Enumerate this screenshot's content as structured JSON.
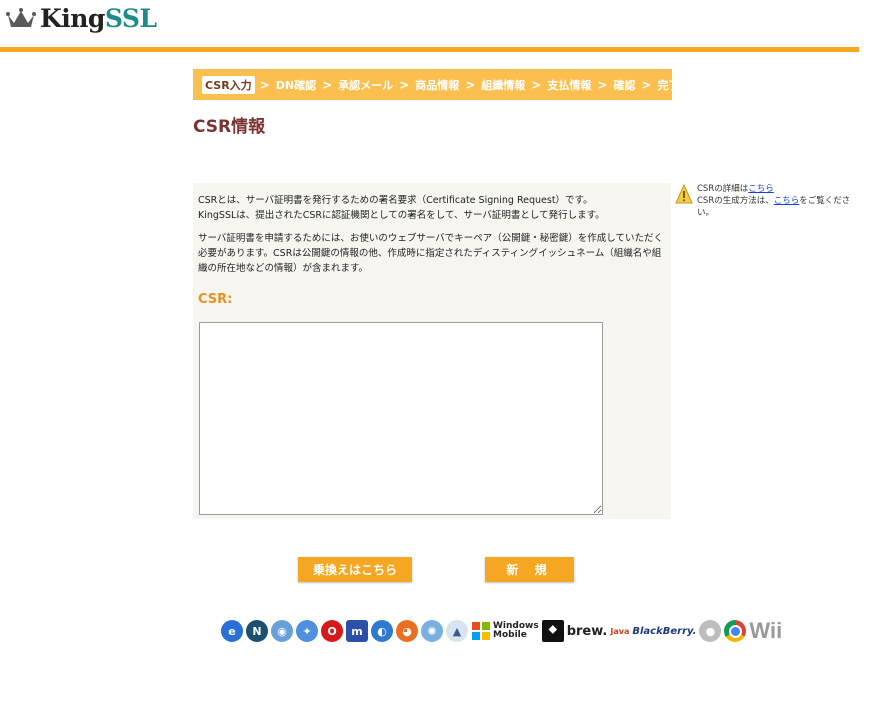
{
  "logo": {
    "text_king": "King",
    "text_ssl": "SSL"
  },
  "steps": [
    {
      "label": "CSR入力",
      "active": true
    },
    {
      "label": "DN確認"
    },
    {
      "label": "承認メール"
    },
    {
      "label": "商品情報"
    },
    {
      "label": "組織情報"
    },
    {
      "label": "支払情報"
    },
    {
      "label": "確認"
    },
    {
      "label": "完了"
    }
  ],
  "step_separator": ">",
  "page_title": "CSR情報",
  "description": {
    "p1_line1": "CSRとは、サーバ証明書を発行するための署名要求（Certificate Signing Request）です。",
    "p1_line2": "KingSSLは、提出されたCSRに認証機関としての署名をして、サーバ証明書として発行します。",
    "p2": "サーバ証明書を申請するためには、お使いのウェブサーバでキーペア（公開鍵・秘密鍵）を作成していただく必要があります。CSRは公開鍵の情報の他、作成時に指定されたディスティングイッシュネーム（組織名や組織の所在地などの情報）が含まれます。"
  },
  "csr_label": "CSR:",
  "csr_value": "",
  "side_note": {
    "line1_prefix": "CSRの詳細は",
    "line1_link": "こちら",
    "line2_prefix": "CSRの生成方法は、",
    "line2_link": "こちら",
    "line2_suffix": "をご覧ください。"
  },
  "buttons": {
    "switch": "乗換えはこちら",
    "new": "新 規"
  },
  "browser_strip": {
    "icons": [
      "ie-icon",
      "netscape-icon",
      "mozilla-icon",
      "safari-icon",
      "opera-icon",
      "konqueror-icon",
      "seamonkey-icon",
      "firefox-icon",
      "camino-icon",
      "android-like-icon",
      "windows-mobile-icon",
      "playstation-icon",
      "brew-icon",
      "java-icon",
      "blackberry-icon",
      "apple-icon",
      "chrome-icon",
      "wii-icon"
    ],
    "windows_mobile_l1": "Windows",
    "windows_mobile_l2": "Mobile",
    "brew": "brew.",
    "java": "Java",
    "blackberry": "BlackBerry.",
    "wii": "Wii"
  },
  "colors": {
    "accent": "#f5a623",
    "title": "#7a3330",
    "csr_label": "#e8911f",
    "link": "#1a3fcf"
  }
}
